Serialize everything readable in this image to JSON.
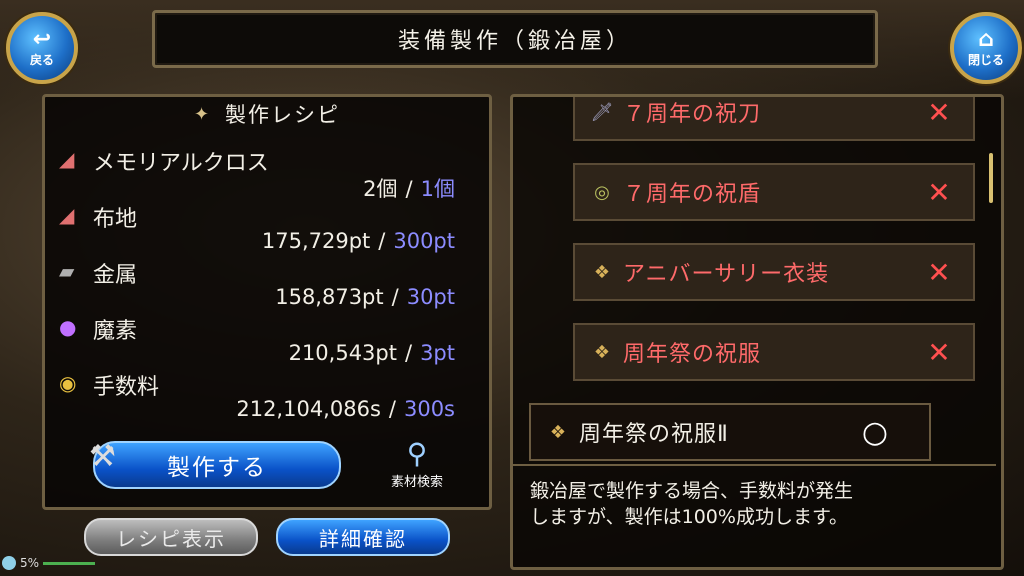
{
  "header": {
    "title": "装備製作（鍛冶屋）",
    "back_icon": "↩",
    "back_label": "戻る",
    "close_icon": "⌂",
    "close_label": "閉じる"
  },
  "recipe": {
    "title": "製作レシピ",
    "title_icon": "✦",
    "materials": [
      {
        "name": "メモリアルクロス",
        "owned": "2個",
        "sep": "/",
        "required": "1個",
        "icon": "cloth-icon"
      },
      {
        "name": "布地",
        "owned": "175,729pt",
        "sep": "/",
        "required": "300pt",
        "icon": "cloth-icon"
      },
      {
        "name": "金属",
        "owned": "158,873pt",
        "sep": "/",
        "required": "30pt",
        "icon": "ingot-icon"
      },
      {
        "name": "魔素",
        "owned": "210,543pt",
        "sep": "/",
        "required": "3pt",
        "icon": "orb-icon"
      },
      {
        "name": "手数料",
        "owned": "212,104,086s",
        "sep": "/",
        "required": "300s",
        "icon": "coin-icon"
      }
    ],
    "craft_label": "製作する",
    "search_label": "素材検索"
  },
  "buttons": {
    "recipe_label": "レシピ表示",
    "detail_label": "詳細確認"
  },
  "list": {
    "items": [
      {
        "name": "７周年の祝刀",
        "mark": "✕"
      },
      {
        "name": "７周年の祝盾",
        "mark": "✕"
      },
      {
        "name": "アニバーサリー衣装",
        "mark": "✕"
      },
      {
        "name": "周年祭の祝服",
        "mark": "✕"
      },
      {
        "name": "周年祭の祝服Ⅱ",
        "mark": "○"
      }
    ]
  },
  "description": {
    "line1": "鍛冶屋で製作する場合、手数料が発生",
    "line2": "しますが、製作は100%成功します。"
  },
  "status": {
    "percent": "5%"
  },
  "colors": {
    "required": "#8c8cff",
    "unavailable": "#ff6a6a",
    "accent_blue": "#0a52c8"
  }
}
